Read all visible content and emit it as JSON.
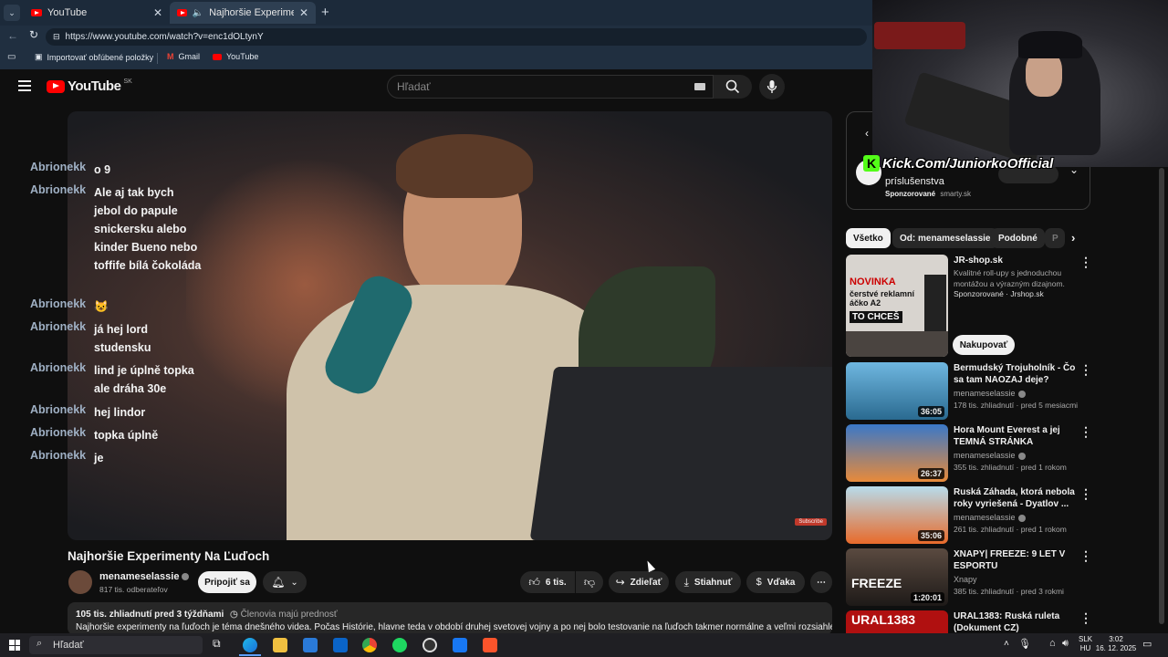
{
  "browser": {
    "tabs": [
      {
        "label": "YouTube"
      },
      {
        "label": "Najhoršie Experimenty Na Ľuďoch"
      }
    ],
    "url": "https://www.youtube.com/watch?v=enc1dOLtynY",
    "bookmarks": [
      {
        "label": "Importovať obľúbené položky"
      },
      {
        "label": "Gmail"
      },
      {
        "label": "YouTube"
      }
    ]
  },
  "youtube": {
    "logo": "YouTube",
    "region": "SK",
    "search_placeholder": "Hľadať"
  },
  "chat": [
    {
      "user": "Abrionekk",
      "msg": "o 9"
    },
    {
      "user": "Abrionekk",
      "msg": "Ale aj tak bych jebol do papule snickersku alebo kinder Bueno nebo toffife bílá čokoláda"
    },
    {
      "user": "Abrionekk",
      "msg": "😺"
    },
    {
      "user": "Abrionekk",
      "msg": "já hej lord studensku"
    },
    {
      "user": "Abrionekk",
      "msg": "lind je úplně topka ale dráha 30e"
    },
    {
      "user": "Abrionekk",
      "msg": "hej lindor"
    },
    {
      "user": "Abrionekk",
      "msg": "topka úplně"
    },
    {
      "user": "Abrionekk",
      "msg": "je"
    }
  ],
  "video": {
    "title": "Najhoršie Experimenty Na Ľuďoch",
    "watermark": "Subscribe",
    "channel": "menameselassie",
    "subscribers": "817 tis. odberateľov",
    "join_label": "Pripojiť sa",
    "likes": "6 tis.",
    "share_label": "Zdieľať",
    "download_label": "Stiahnuť",
    "thanks_label": "Vďaka",
    "views_date": "105 tis. zhliadnutí  pred 3 týždňami",
    "members_label": "Členovia majú prednosť",
    "description": "Najhoršie experimenty na ľuďoch je téma dnešného videa. Počas Histórie, hlavne teda v období druhej svetovej vojny a po nej bolo testovanie na ľuďoch takmer normálne a veľmi rozsiahle. Dali sme"
  },
  "sidebar": {
    "ad_top": {
      "title": "príslušenstva",
      "sponsored": "Sponzorované",
      "domain": "smarty.sk"
    },
    "overlay_text": "Kick.Com/JuniorkoOfficial",
    "chips": [
      "Všetko",
      "Od: menameselassie",
      "Podobné",
      "P"
    ],
    "ad": {
      "title": "JR-shop.sk",
      "desc": "Kvalitné roll-upy s jednoduchou montážou a výrazným dizajnom.",
      "sponsored": "Sponzorované · Jrshop.sk",
      "cta": "Nakupovať",
      "thumb_text_1": "NOVINKA",
      "thumb_text_2": "čerstvé reklamní áčko A2",
      "thumb_text_3": "TO CHCEŠ"
    },
    "recs": [
      {
        "title": "Bermudský Trojuholník - Čo sa tam NAOZAJ deje?",
        "channel": "menameselassie",
        "meta": "178 tis. zhliadnutí · pred 5 mesiacmi",
        "duration": "36:05",
        "color": "#2a7fb0"
      },
      {
        "title": "Hora Mount Everest a jej TEMNÁ STRÁNKA",
        "channel": "menameselassie",
        "meta": "355 tis. zhliadnutí · pred 1 rokom",
        "duration": "26:37",
        "color": "#4a7fc0"
      },
      {
        "title": "Ruská Záhada, ktorá nebola roky vyriešená - Dyatlov ...",
        "channel": "menameselassie",
        "meta": "261 tis. zhliadnutí · pred 1 rokom",
        "duration": "35:06",
        "color": "#8ab8cf"
      },
      {
        "title": "XNAPY| FREEZE: 9 LET V ESPORTU",
        "channel": "Xnapy",
        "meta": "385 tis. zhliadnutí · pred 3 rokmi",
        "duration": "1:20:01",
        "color": "#3a3330",
        "thumb_text": "FREEZE"
      },
      {
        "title": "URAL1383: Ruská ruleta (Dokument CZ)",
        "channel": "",
        "meta": "",
        "duration": "",
        "color": "#b01010",
        "thumb_text": "URAL1383"
      }
    ]
  },
  "taskbar": {
    "search": "Hľadať",
    "lang": "SLK",
    "lang2": "HU",
    "time": "3:02",
    "date": "16. 12. 2025"
  }
}
